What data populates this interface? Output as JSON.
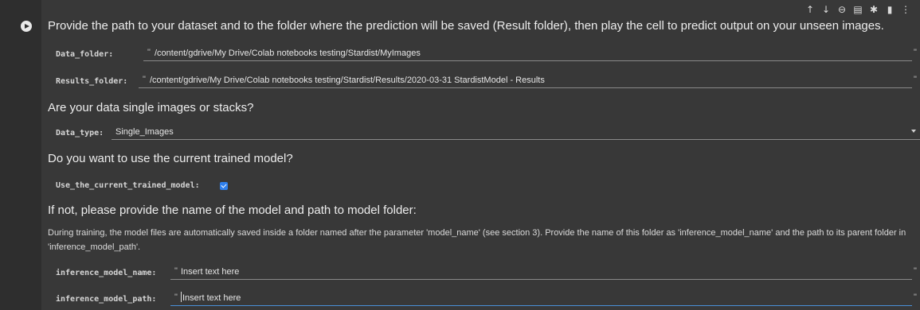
{
  "toolbar": {
    "icons": [
      "arrow-up-icon",
      "arrow-down-icon",
      "link-icon",
      "comment-icon",
      "gear-icon",
      "trash-icon",
      "more-vert-icon"
    ],
    "glyphs": [
      "↑",
      "↓",
      "⊖",
      "▤",
      "✱",
      "▮",
      "⋮"
    ]
  },
  "cell": {
    "intro": "Provide the path to your dataset and to the folder where the prediction will be saved (Result folder), then play the cell to predict output on your unseen images.",
    "data_folder": {
      "label": "Data_folder:",
      "value": "/content/gdrive/My Drive/Colab notebooks testing/Stardist/MyImages"
    },
    "results_folder": {
      "label": "Results_folder:",
      "value": "/content/gdrive/My Drive/Colab notebooks testing/Stardist/Results/2020-03-31 StardistModel - Results"
    },
    "q_single": "Are your data single images or stacks?",
    "data_type": {
      "label": "Data_type:",
      "value": "Single_Images"
    },
    "q_current_model": "Do you want to use the current trained model?",
    "use_current": {
      "label": "Use_the_current_trained_model:",
      "checked": true
    },
    "q_if_not": "If not, please provide the name of the model and path to model folder:",
    "description": "During training, the model files are automatically saved inside a folder named after the parameter 'model_name' (see section 3). Provide the name of this folder as 'inference_model_name' and the path to its parent folder in 'inference_model_path'.",
    "inference_name": {
      "label": "inference_model_name:",
      "placeholder": "Insert text here"
    },
    "inference_path": {
      "label": "inference_model_path:",
      "placeholder": "Insert text here"
    },
    "open_quote": "\"",
    "close_quote": "\""
  },
  "colors": {
    "background": "#383838",
    "accent": "#4a90d9",
    "checkbox": "#2f80ed"
  }
}
